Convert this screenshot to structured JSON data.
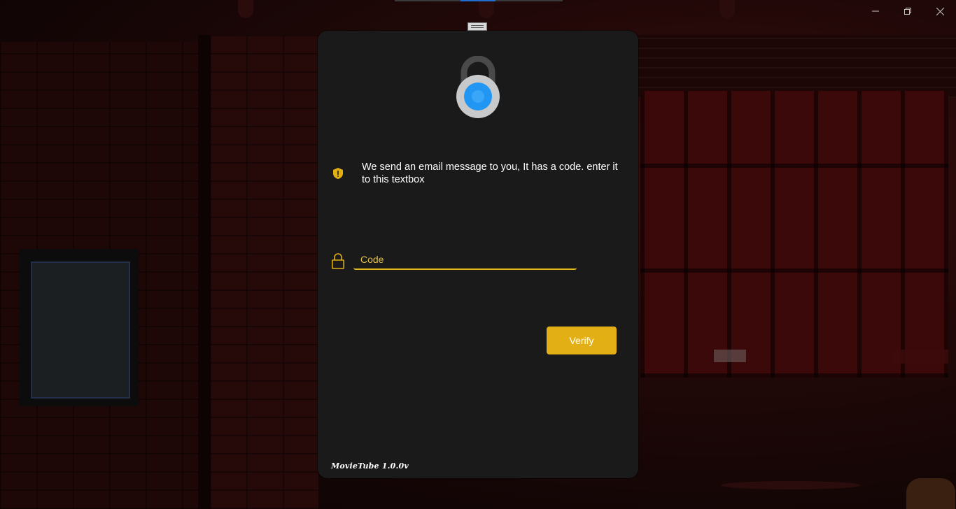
{
  "window": {
    "minimize_glyph": "minimize-icon",
    "restore_glyph": "restore-icon",
    "close_glyph": "close-icon"
  },
  "dialog": {
    "hero_icon": "padlock-icon",
    "info_icon": "shield-warning-icon",
    "message": "We send an email message to you, It has a code. enter it to this textbox",
    "code_icon": "lock-icon",
    "code_placeholder": "Code",
    "code_value": "",
    "verify_label": "Verify",
    "version_text": "MovieTube 1.0.0v"
  },
  "colors": {
    "accent": "#e2b015",
    "dialog_bg": "#1a1a1a",
    "hero_blue": "#2196f3"
  }
}
